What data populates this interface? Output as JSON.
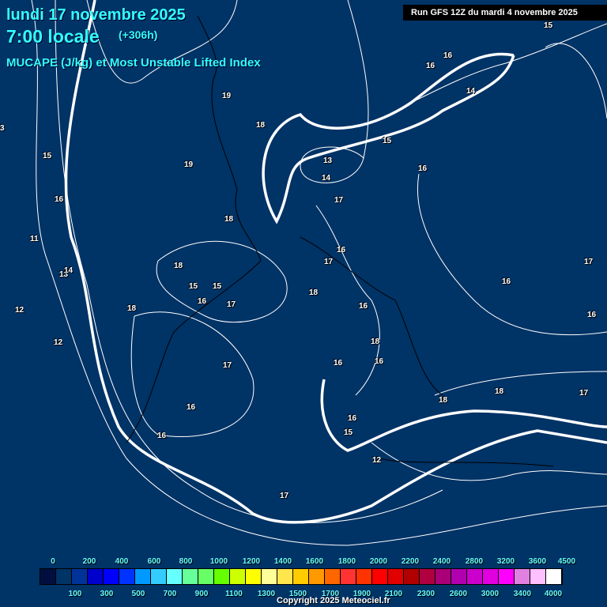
{
  "header": {
    "date": "lundi 17 novembre 2025",
    "time": "7:00 locale",
    "offset": "(+306h)",
    "parameter": "MUCAPE (J/kg) et Most Unstable Lifted Index",
    "run": "Run GFS 12Z du mardi 4 novembre 2025"
  },
  "contour_labels": [
    "15",
    "16",
    "16",
    "14",
    "19",
    "18",
    "19",
    "13",
    "14",
    "15",
    "16",
    "17",
    "18",
    "16",
    "17",
    "18",
    "15",
    "15",
    "16",
    "17",
    "18",
    "16",
    "17",
    "18",
    "16",
    "16",
    "18",
    "17",
    "16",
    "16",
    "18",
    "17",
    "18",
    "15",
    "16",
    "12",
    "17",
    "15",
    "16",
    "11",
    "13",
    "14",
    "12",
    "12",
    "3"
  ],
  "legend": {
    "top_labels": [
      "0",
      "200",
      "400",
      "600",
      "800",
      "1000",
      "1200",
      "1400",
      "1600",
      "1800",
      "2000",
      "2200",
      "2400",
      "2800",
      "3200",
      "3600",
      "4500"
    ],
    "bottom_labels": [
      "100",
      "300",
      "500",
      "700",
      "900",
      "1100",
      "1300",
      "1500",
      "1700",
      "1900",
      "2100",
      "2300",
      "2600",
      "3000",
      "3400",
      "4000"
    ],
    "colors": [
      "#000f3f",
      "#003366",
      "#003399",
      "#0000cc",
      "#0000ff",
      "#0033ff",
      "#0099ff",
      "#33ccff",
      "#66ffff",
      "#66ff99",
      "#66ff66",
      "#66ff00",
      "#ccff00",
      "#ffff00",
      "#ffff99",
      "#ffe64d",
      "#ffcc00",
      "#ff9900",
      "#ff6600",
      "#ff3333",
      "#ff3300",
      "#ff0000",
      "#e00000",
      "#b00000",
      "#b00040",
      "#aa0077",
      "#b000b0",
      "#cc00cc",
      "#e000e0",
      "#ff00ff",
      "#e080e0",
      "#ffc0ff",
      "#ffffff"
    ]
  },
  "copyright": "Copyright 2025 Meteociel.fr"
}
